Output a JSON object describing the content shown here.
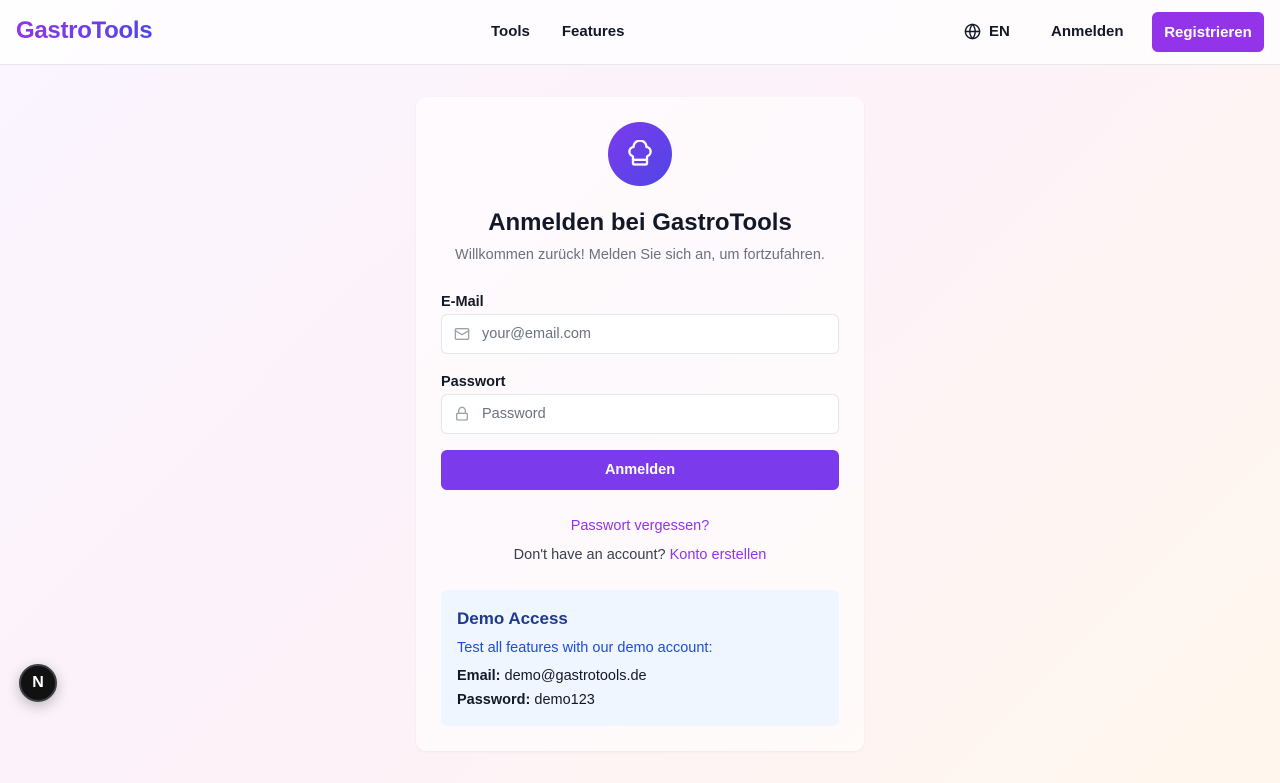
{
  "nav": {
    "brand": "GastroTools",
    "links": [
      "Tools",
      "Features"
    ],
    "language": "EN",
    "login_label": "Anmelden",
    "register_label": "Registrieren"
  },
  "login_card": {
    "icon": "chef-hat-icon",
    "title": "Anmelden bei GastroTools",
    "subtitle": "Willkommen zurück! Melden Sie sich an, um fortzufahren.",
    "email": {
      "label": "E-Mail",
      "placeholder": "your@email.com",
      "value": "",
      "icon": "mail-icon"
    },
    "password": {
      "label": "Passwort",
      "placeholder": "Password",
      "value": "",
      "icon": "lock-icon"
    },
    "submit_label": "Anmelden",
    "forgot_label": "Passwort vergessen?",
    "signup_prompt": "Don't have an account?",
    "signup_link": "Konto erstellen"
  },
  "demo": {
    "title": "Demo Access",
    "text": "Test all features with our demo account:",
    "email_label": "Email:",
    "email_value": "demo@gastrotools.de",
    "password_label": "Password:",
    "password_value": "demo123"
  },
  "dev_badge": {
    "letter": "N",
    "icon": "nextjs-icon"
  },
  "colors": {
    "accent": "#9333ea",
    "button": "#7c3aed",
    "demo_bg": "#eff6ff",
    "demo_title": "#1e3a8a"
  }
}
